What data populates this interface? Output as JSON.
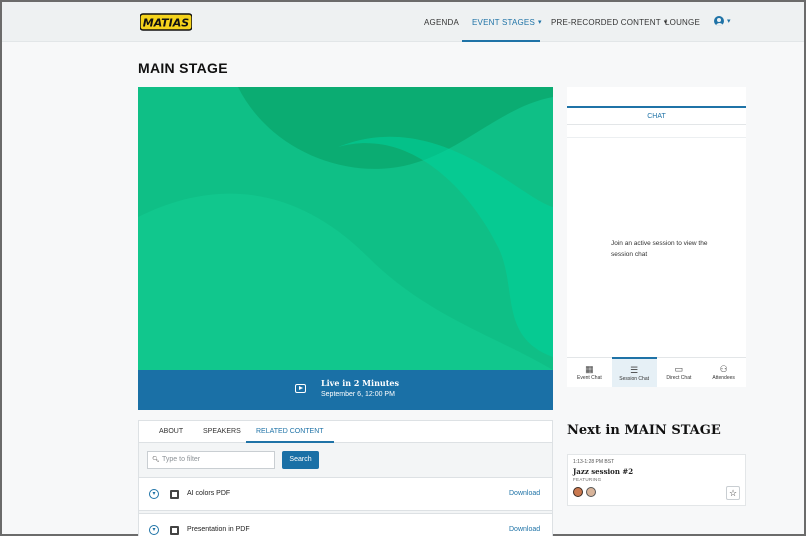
{
  "header": {
    "logo_text": "MATIAS",
    "nav": [
      {
        "label": "AGENDA"
      },
      {
        "label": "EVENT STAGES"
      },
      {
        "label": "PRE-RECORDED CONTENT"
      },
      {
        "label": "LOUNGE"
      }
    ],
    "chevron": "⌄",
    "user_icon": "user-circle-icon"
  },
  "page": {
    "title": "MAIN STAGE"
  },
  "video": {
    "status": "Live in 2 Minutes",
    "datetime": "September 6, 12:00 PM",
    "colors": {
      "base": "#0fbf86",
      "bar": "#1a70a6"
    }
  },
  "chat": {
    "tab_label": "CHAT",
    "message": "Join an active session to view the session chat",
    "bottom_tabs": [
      {
        "label": "Event Chat",
        "icon": "calendar-icon"
      },
      {
        "label": "Session Chat",
        "icon": "chat-bubbles-icon",
        "active": true
      },
      {
        "label": "Direct Chat",
        "icon": "message-icon"
      },
      {
        "label": "Attendees",
        "icon": "people-icon"
      }
    ]
  },
  "content_tabs": {
    "tabs": [
      {
        "label": "ABOUT"
      },
      {
        "label": "SPEAKERS"
      },
      {
        "label": "RELATED CONTENT",
        "active": true
      }
    ],
    "filter_placeholder": "Type to filter",
    "search_label": "Search",
    "files": [
      {
        "name": "AI colors PDF",
        "action": "Download"
      },
      {
        "name": "Presentation in PDF",
        "action": "Download"
      }
    ]
  },
  "next": {
    "title": "Next in MAIN STAGE",
    "session": {
      "time": "1:13-1:28 PM BST",
      "title": "Jazz session #2",
      "featuring": "FEATURING"
    }
  },
  "colors": {
    "accent": "#1f73a7",
    "background": "#f7f8f9"
  }
}
